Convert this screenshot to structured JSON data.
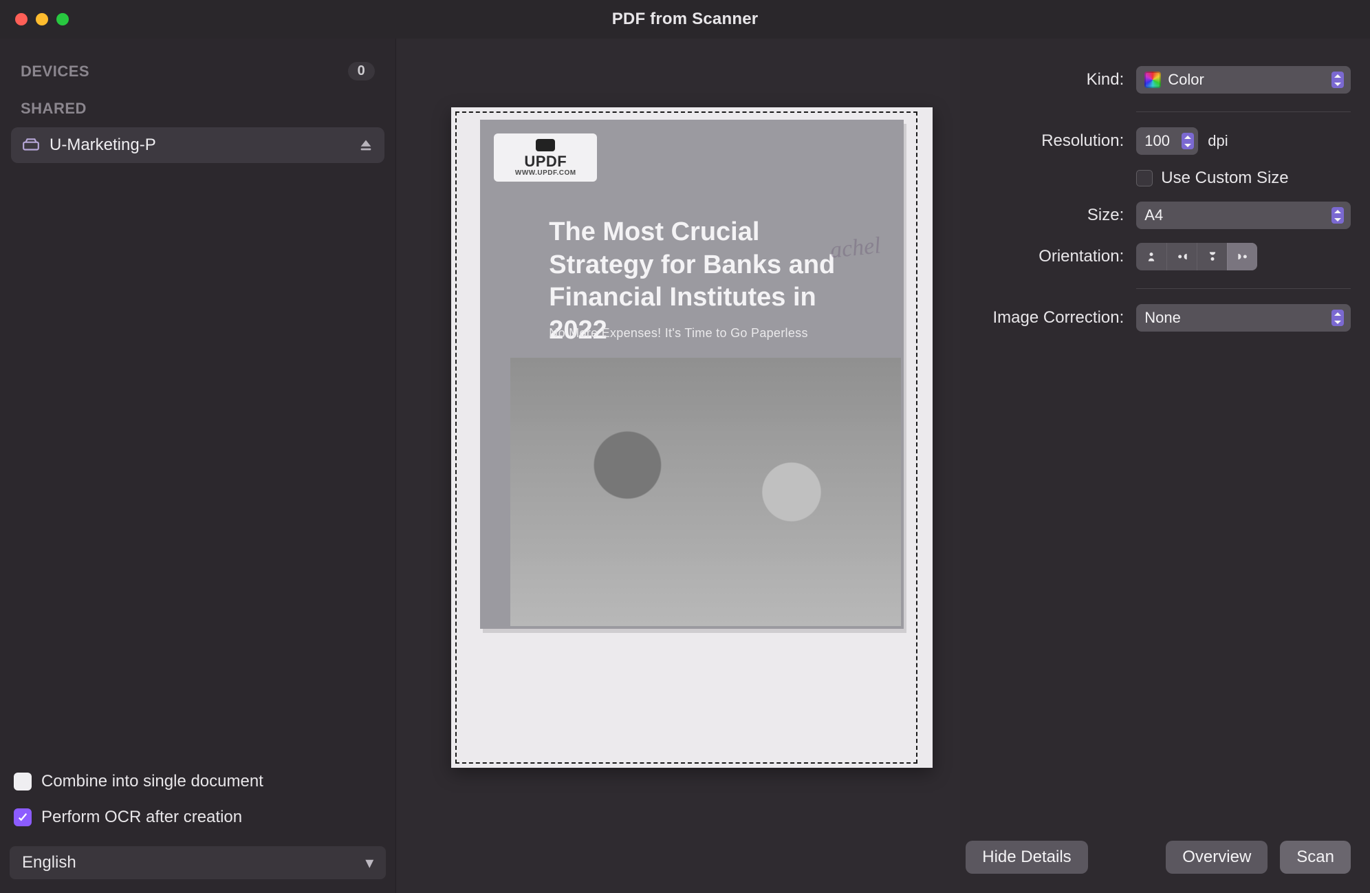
{
  "window": {
    "title": "PDF from Scanner"
  },
  "sidebar": {
    "devices_label": "DEVICES",
    "devices_count": "0",
    "shared_label": "SHARED",
    "device_name": "U-Marketing-P",
    "combine_label": "Combine into single document",
    "ocr_label": "Perform OCR after creation",
    "language_value": "English"
  },
  "preview": {
    "logo": "UPDF",
    "logo_sub": "WWW.UPDF.COM",
    "headline": "The Most Crucial Strategy for Banks and Financial Institutes in 2022",
    "subtitle": "No More Expenses! It's Time to Go Paperless",
    "watermark": "achel"
  },
  "settings": {
    "kind_label": "Kind:",
    "kind_value": "Color",
    "resolution_label": "Resolution:",
    "resolution_value": "100",
    "resolution_unit": "dpi",
    "use_custom_size_label": "Use Custom Size",
    "size_label": "Size:",
    "size_value": "A4",
    "orientation_label": "Orientation:",
    "image_correction_label": "Image Correction:",
    "image_correction_value": "None"
  },
  "footer": {
    "hide_details": "Hide Details",
    "overview": "Overview",
    "scan": "Scan"
  }
}
